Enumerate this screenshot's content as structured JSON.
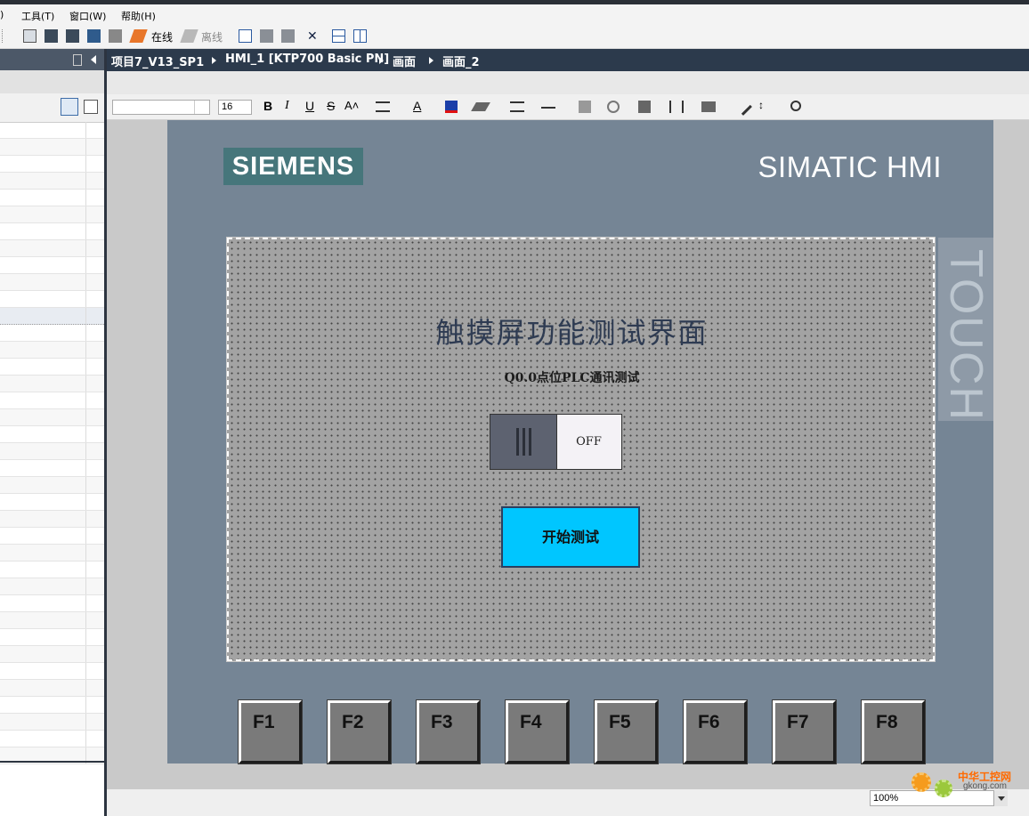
{
  "menu": {
    "items": [
      ")",
      "工具(T)",
      "窗口(W)",
      "帮助(H)"
    ]
  },
  "toolbar": {
    "online_label": "在线",
    "offline_label": "离线"
  },
  "breadcrumb": {
    "items": [
      "项目7_V13_SP1",
      "HMI_1 [KTP700 Basic PN]",
      "画面",
      "画面_2"
    ]
  },
  "format_toolbar": {
    "font_size": "16",
    "bold": "B",
    "italic": "I",
    "underline": "U",
    "strike": "S",
    "font_color_letter": "A"
  },
  "hmi": {
    "logo": "SIEMENS",
    "product": "SIMATIC HMI",
    "touch_label": "TOUCH",
    "title": "触摸屏功能测试界面",
    "subtitle": "Q0.0点位PLC通讯测试",
    "switch_state": "OFF",
    "start_button": "开始测试",
    "function_keys": [
      "F1",
      "F2",
      "F3",
      "F4",
      "F5",
      "F6",
      "F7",
      "F8"
    ]
  },
  "status": {
    "zoom": "100%"
  },
  "watermark": {
    "site_name": "中华工控网",
    "url": "gkong.com"
  },
  "colors": {
    "hmi_frame": "#758595",
    "siemens_teal": "#46767b",
    "start_button": "#00c6ff",
    "breadcrumb_bg": "#2c3a4c"
  }
}
